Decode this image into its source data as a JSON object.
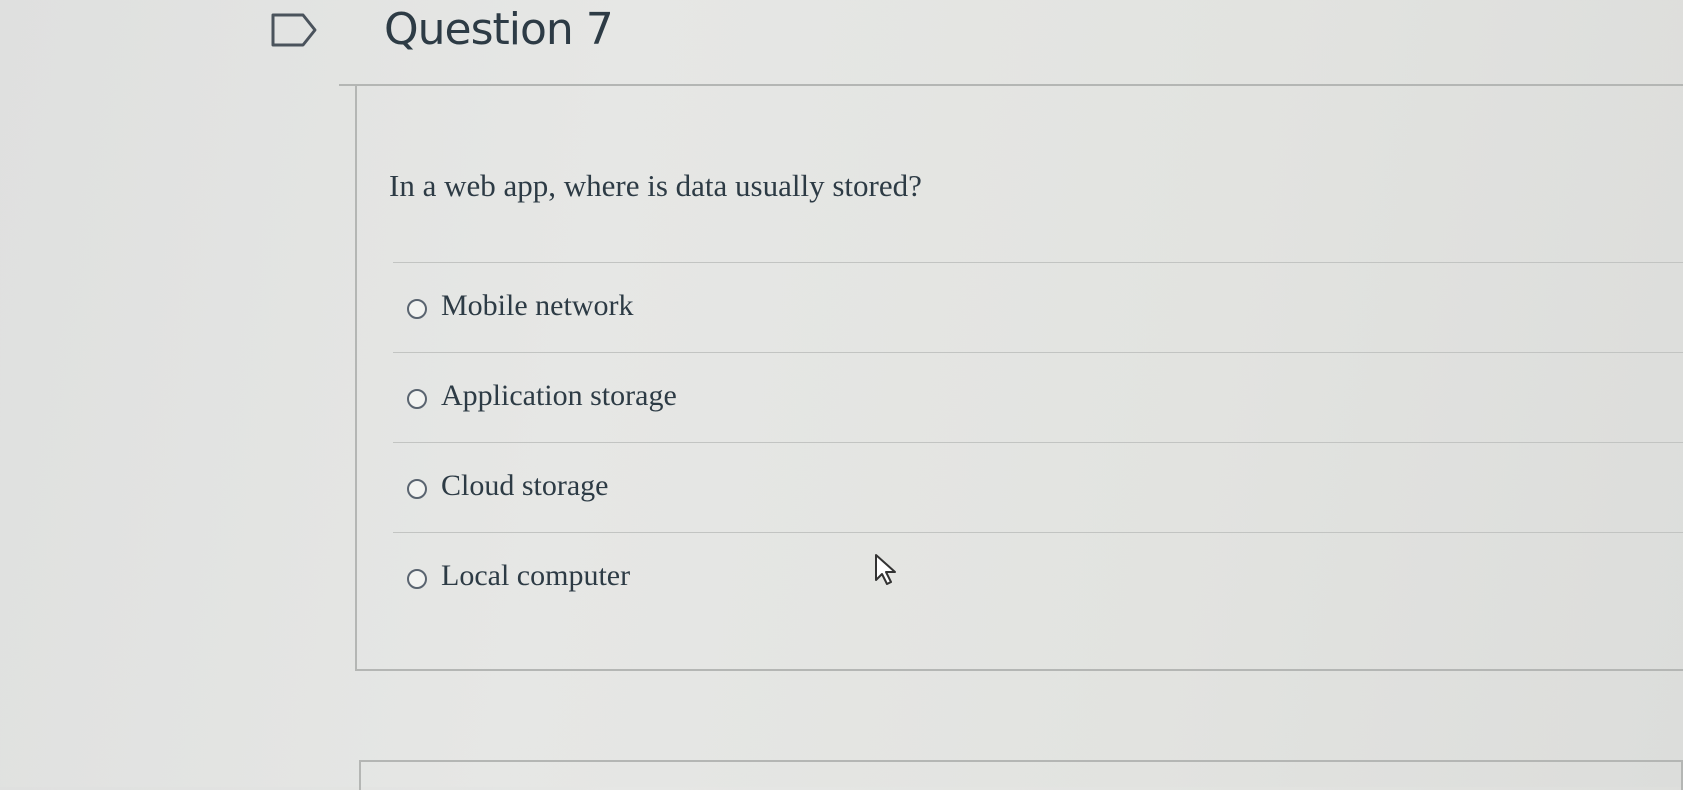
{
  "question": {
    "title": "Question 7",
    "text": "In a web app, where is data usually stored?",
    "flag_icon": "flag-question-icon"
  },
  "answers": [
    {
      "label": "Mobile network",
      "selected": false
    },
    {
      "label": "Application storage",
      "selected": false
    },
    {
      "label": "Cloud storage",
      "selected": false
    },
    {
      "label": "Local computer",
      "selected": false
    }
  ],
  "cursor_icon": "mouse-pointer-icon",
  "colors": {
    "text": "#2d3b45",
    "border": "#b4b6b4",
    "background": "#e2e3e0"
  }
}
